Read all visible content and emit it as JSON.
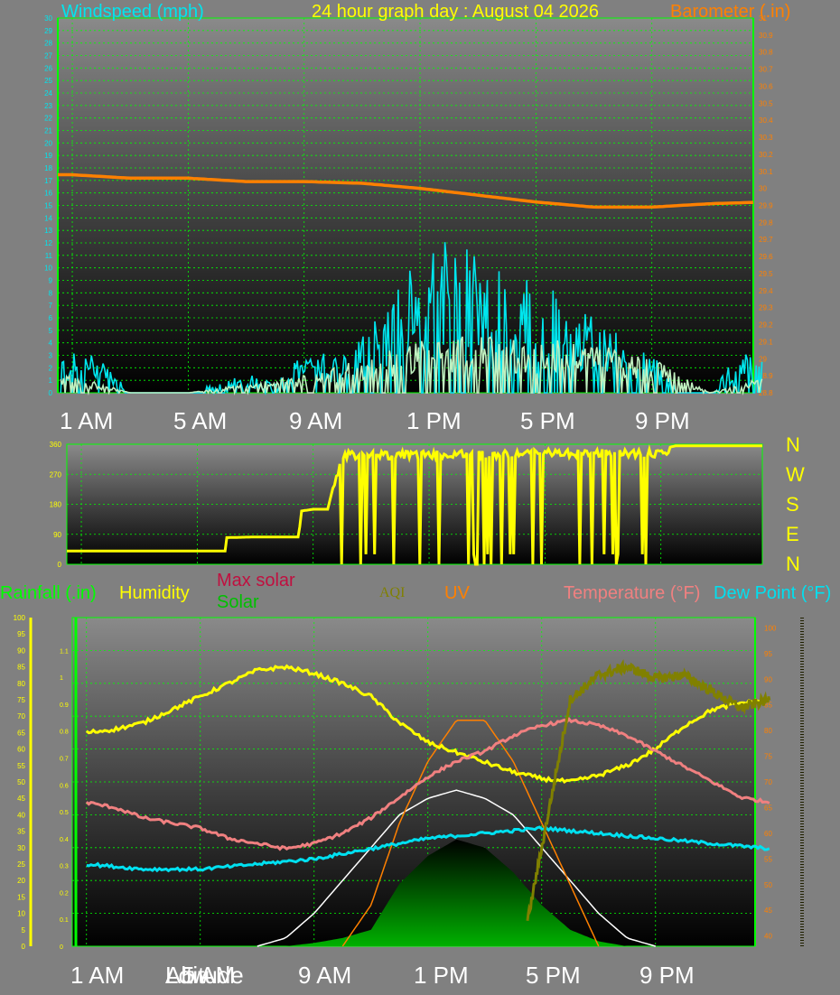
{
  "header": {
    "windspeed_label": "Windspeed (mph)",
    "title": "24 hour graph day : August 04 2026",
    "barometer_label": "Barometer (.in)"
  },
  "lower_header": {
    "rainfall": "Rainfall (.in)",
    "humidity": "Humidity",
    "max_solar": "Max solar",
    "solar": "Solar",
    "aqi": "AQI",
    "uv": "UV",
    "temperature": "Temperature (°F)",
    "dew_point": "Dew Point (°F)"
  },
  "time_labels": [
    "1 AM",
    "5 AM",
    "9 AM",
    "1 PM",
    "5 PM",
    "9 PM"
  ],
  "compass": [
    "N",
    "W",
    "S",
    "E",
    "N"
  ],
  "bottom_extra_labels": {
    "low": "Low",
    "altitude": "Altitude"
  },
  "colors": {
    "wind": "#00e5ee",
    "gust": "#c0f0c0",
    "barometer": "#ff8000",
    "direction": "#ffff00",
    "humidity": "#ffff00",
    "temperature": "#f08080",
    "dew_point": "#00e0f0",
    "uv": "#ff8000",
    "aqi": "#808000",
    "max_solar": "#ffffff",
    "solar": "#00a000",
    "grid": "#00ff00",
    "axis": "#00ff00"
  },
  "chart_data": [
    {
      "type": "line",
      "title": "24 hour graph day : August 04 2026",
      "xlabel": "",
      "x_ticks": [
        "1 AM",
        "5 AM",
        "9 AM",
        "1 PM",
        "5 PM",
        "9 PM"
      ],
      "y_left_label": "Windspeed (mph)",
      "y_left_range": [
        0,
        30
      ],
      "y_left_ticks": [
        0,
        1,
        2,
        3,
        4,
        5,
        6,
        7,
        8,
        9,
        10,
        11,
        12,
        13,
        14,
        15,
        16,
        17,
        18,
        19,
        20,
        21,
        22,
        23,
        24,
        25,
        26,
        27,
        28,
        29,
        30
      ],
      "y_right_label": "Barometer (.in)",
      "y_right_range": [
        28.8,
        31
      ],
      "y_right_ticks": [
        "28.8",
        "28.9",
        "29",
        "29.1",
        "29.2",
        "29.3",
        "29.4",
        "29.5",
        "29.6",
        "29.7",
        "29.8",
        "29.9",
        "30",
        "30.1",
        "30.2",
        "30.3",
        "30.4",
        "30.5",
        "30.6",
        "30.7",
        "30.8",
        "30.9",
        "31"
      ],
      "grid": true,
      "series": [
        {
          "name": "Barometer (.in)",
          "axis": "right",
          "x_hours": [
            0,
            2,
            4,
            6,
            8,
            10,
            12,
            14,
            16,
            18,
            20,
            22,
            24
          ],
          "values": [
            30.08,
            30.06,
            30.06,
            30.04,
            30.04,
            30.03,
            30.0,
            29.96,
            29.92,
            29.89,
            29.89,
            29.91,
            29.92
          ]
        },
        {
          "name": "Windspeed (mph)",
          "axis": "left",
          "x_hours": [
            0,
            1,
            2,
            3,
            4,
            5,
            6,
            7,
            8,
            9,
            10,
            11,
            12,
            13,
            14,
            15,
            16,
            17,
            18,
            19,
            20,
            21,
            22,
            23,
            24
          ],
          "values": [
            2,
            2,
            0,
            0,
            0,
            0.5,
            1,
            0.5,
            2,
            2,
            3,
            5,
            7,
            8,
            7,
            6,
            6,
            5,
            4,
            3,
            2,
            0,
            0,
            2,
            2
          ]
        },
        {
          "name": "Gust",
          "axis": "left",
          "x_hours": [
            0,
            2,
            4,
            6,
            8,
            10,
            12,
            14,
            16,
            18,
            20,
            22,
            24
          ],
          "values": [
            1,
            0,
            0,
            0.5,
            1,
            2,
            3,
            3.5,
            3,
            3,
            2,
            0,
            1
          ]
        }
      ]
    },
    {
      "type": "line",
      "title": "",
      "y_range": [
        0,
        360
      ],
      "y_ticks": [
        0,
        90,
        180,
        270,
        360
      ],
      "right_labels": [
        "N",
        "W",
        "S",
        "E",
        "N"
      ],
      "series": [
        {
          "name": "Wind direction",
          "x_hours": [
            0,
            1,
            2,
            3,
            4,
            5,
            5.01,
            6,
            7,
            7.5,
            7.6,
            8,
            8.5,
            9,
            12,
            16,
            20,
            20.5,
            24
          ],
          "values": [
            40,
            40,
            40,
            40,
            40,
            40,
            80,
            82,
            82,
            82,
            160,
            165,
            165,
            340,
            340,
            345,
            345,
            355,
            355
          ]
        }
      ]
    },
    {
      "type": "line",
      "title": "",
      "x_ticks": [
        "1 AM",
        "5 AM",
        "9 AM",
        "1 PM",
        "5 PM",
        "9 PM"
      ],
      "y_rain_range": [
        0,
        1.1
      ],
      "y_rain_ticks": [
        "0",
        "0.1",
        "0.2",
        "0.3",
        "0.4",
        "0.5",
        "0.6",
        "0.7",
        "0.8",
        "0.9",
        "1",
        "1.1"
      ],
      "y_humidity_range": [
        0,
        100
      ],
      "y_humidity_ticks": [
        0,
        5,
        10,
        15,
        20,
        25,
        30,
        35,
        40,
        45,
        50,
        55,
        60,
        65,
        70,
        75,
        80,
        85,
        90,
        95,
        100
      ],
      "y_temp_range": [
        38,
        102
      ],
      "y_temp_ticks": [
        40,
        45,
        50,
        55,
        60,
        65,
        70,
        75,
        80,
        85,
        90,
        95,
        100
      ],
      "grid": true,
      "series": [
        {
          "name": "Humidity",
          "x_hours": [
            0,
            1,
            2,
            3,
            4,
            5,
            6,
            7,
            8,
            9,
            10,
            11,
            12,
            13,
            14,
            15,
            16,
            17,
            18,
            19,
            20,
            21,
            22,
            23,
            24
          ],
          "values": [
            65,
            66,
            68,
            72,
            76,
            80,
            84,
            85,
            83,
            80,
            76,
            68,
            62,
            59,
            56,
            53,
            51,
            50,
            52,
            55,
            60,
            67,
            72,
            74,
            75
          ]
        },
        {
          "name": "Temperature (°F)",
          "x_hours": [
            0,
            1,
            2,
            3,
            4,
            5,
            6,
            7,
            8,
            9,
            10,
            11,
            12,
            13,
            14,
            15,
            16,
            17,
            18,
            19,
            20,
            21,
            22,
            23,
            24
          ],
          "values": [
            66,
            65,
            63,
            62,
            61,
            59,
            58,
            57,
            58,
            60,
            63,
            67,
            71,
            74,
            76,
            79,
            81,
            82,
            81,
            79,
            76,
            73,
            70,
            67,
            66
          ]
        },
        {
          "name": "Dew Point (°F)",
          "x_hours": [
            0,
            2,
            4,
            6,
            8,
            10,
            12,
            14,
            16,
            18,
            20,
            22,
            24
          ],
          "values": [
            54,
            53,
            53,
            54,
            55,
            57,
            59,
            60,
            61,
            60,
            59,
            58,
            57
          ]
        },
        {
          "name": "AQI",
          "x_hours": [
            15.5,
            16,
            17,
            18,
            19,
            20,
            21,
            22,
            23,
            24
          ],
          "values": [
            15,
            60,
            150,
            165,
            170,
            163,
            165,
            155,
            145,
            150
          ]
        },
        {
          "name": "UV",
          "x_hours": [
            9,
            10,
            11,
            12,
            13,
            14,
            15,
            16,
            17,
            18
          ],
          "values": [
            0,
            1,
            3,
            4.5,
            5.5,
            5.5,
            4.5,
            3,
            1.5,
            0
          ]
        },
        {
          "name": "Max solar",
          "x_hours": [
            6,
            7,
            8,
            9,
            10,
            11,
            12,
            13,
            14,
            15,
            16,
            17,
            18,
            19,
            20
          ],
          "values": [
            0,
            50,
            200,
            400,
            600,
            800,
            900,
            950,
            900,
            800,
            600,
            400,
            200,
            50,
            0
          ]
        },
        {
          "name": "Solar",
          "x_hours": [
            7,
            8,
            9,
            10,
            11,
            12,
            13,
            14,
            15,
            16,
            17,
            18,
            19
          ],
          "values": [
            0,
            20,
            50,
            100,
            380,
            550,
            650,
            600,
            450,
            250,
            100,
            30,
            0
          ]
        }
      ]
    }
  ]
}
